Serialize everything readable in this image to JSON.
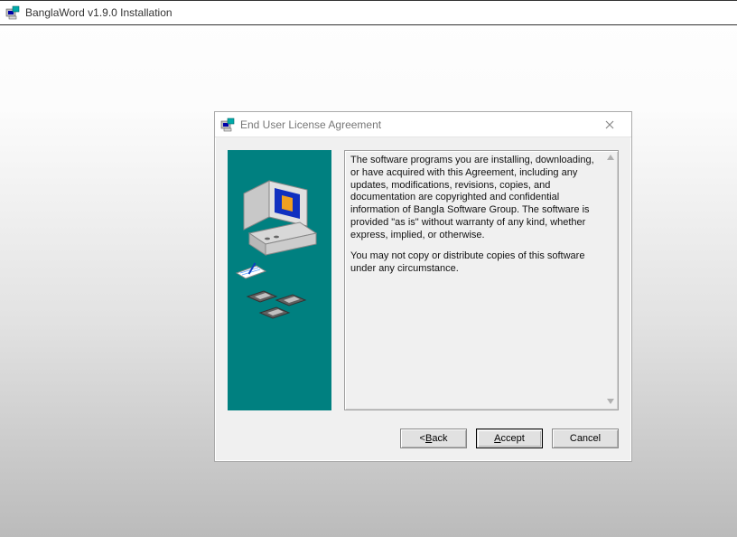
{
  "top": {
    "title": "BanglaWord v1.9.0 Installation"
  },
  "dialog": {
    "title": "End User License Agreement",
    "eula_p1": "The software programs you are installing, downloading, or have acquired with this Agreement, including any updates, modifications, revisions, copies, and documentation are copyrighted and confidential information of Bangla Software Group. The software is provided \"as is\" without warranty of any kind, whether express, implied, or otherwise.",
    "eula_p2": "You may not copy or distribute copies of this software under any circumstance.",
    "buttons": {
      "back_prefix": "< ",
      "back_u": "B",
      "back_rest": "ack",
      "accept_u": "A",
      "accept_rest": "ccept",
      "cancel": "Cancel"
    }
  }
}
